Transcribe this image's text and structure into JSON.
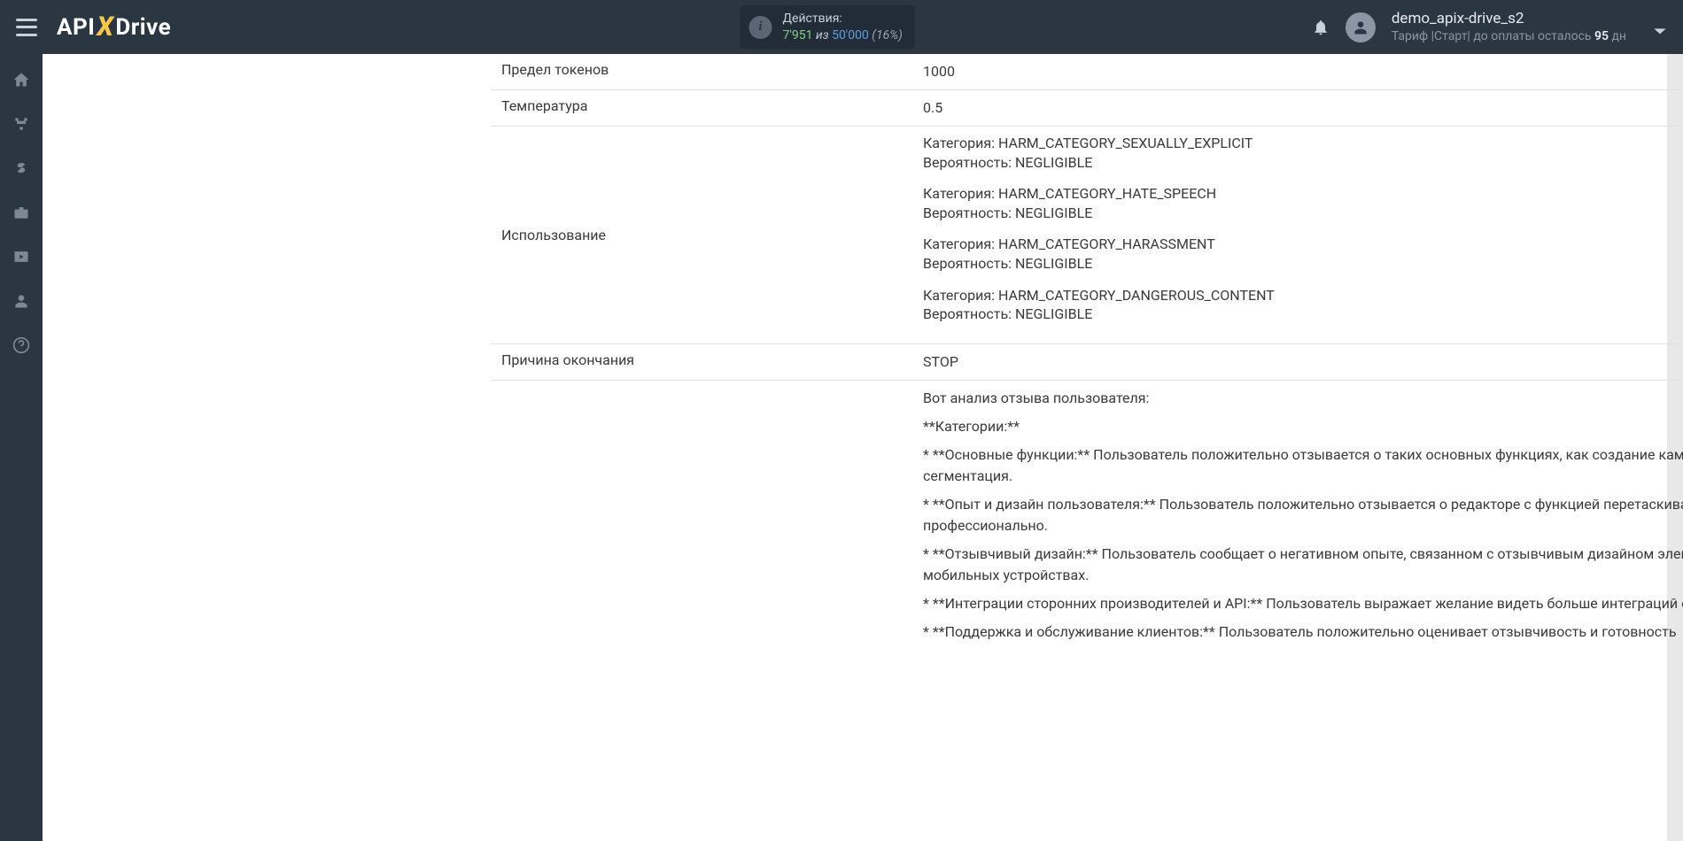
{
  "header": {
    "actions_label": "Действия:",
    "actions_used": "7'951",
    "actions_of": " из ",
    "actions_total": "50'000",
    "actions_pct": " (16%)",
    "user_name": "demo_apix-drive_s2",
    "plan_prefix": "Тариф |Старт|  до оплаты осталось ",
    "plan_days": "95",
    "plan_suffix": " дн"
  },
  "rows": {
    "token_limit_label": "Предел токенов",
    "token_limit_value": "1000",
    "temperature_label": "Температура",
    "temperature_value": "0.5",
    "usage_label": "Использование",
    "usage": [
      {
        "cat": "Категория: HARM_CATEGORY_SEXUALLY_EXPLICIT",
        "prob": "Вероятность: NEGLIGIBLE"
      },
      {
        "cat": "Категория: HARM_CATEGORY_HATE_SPEECH",
        "prob": "Вероятность: NEGLIGIBLE"
      },
      {
        "cat": "Категория: HARM_CATEGORY_HARASSMENT",
        "prob": "Вероятность: NEGLIGIBLE"
      },
      {
        "cat": "Категория: HARM_CATEGORY_DANGEROUS_CONTENT",
        "prob": "Вероятность: NEGLIGIBLE"
      }
    ],
    "finish_label": "Причина окончания",
    "finish_value": "STOP",
    "analysis_intro": "Вот анализ отзыва пользователя:",
    "analysis_cat_header": "**Категории:**",
    "analysis_lines": [
      "* **Основные функции:** Пользователь положительно отзывается о таких основных функциях, как создание кампаний, шаблоны писем, управление контактами и сегментация.",
      "* **Опыт и дизайн пользователя:** Пользователь положительно отзывается о редакторе с функцией перетаскивания, благодаря которому электронные письма выглядят профессионально.",
      "* **Отзывчивый дизайн:** Пользователь сообщает о негативном опыте, связанном с отзывчивым дизайном электронных писем, которые выглядят \"поломанными\" на мобильных устройствах.",
      "* **Интеграции сторонних производителей и API:** Пользователь выражает желание видеть больше интеграций с популярными инструментами CRM.",
      "* **Поддержка и обслуживание клиентов:** Пользователь положительно оценивает отзывчивость и готовность"
    ]
  }
}
